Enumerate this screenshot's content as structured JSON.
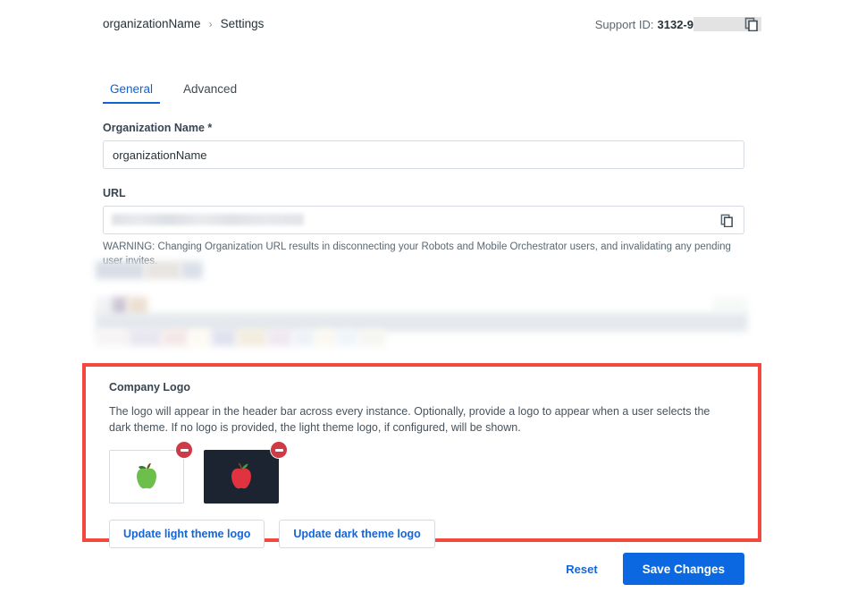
{
  "breadcrumb": {
    "organization": "organizationName",
    "separator": "›",
    "current": "Settings"
  },
  "support": {
    "label": "Support ID:",
    "value": "3132-9",
    "copy_icon": "copy-icon"
  },
  "tabs": [
    {
      "label": "General",
      "active": true
    },
    {
      "label": "Advanced",
      "active": false
    }
  ],
  "form": {
    "org_name": {
      "label": "Organization Name *",
      "value": "organizationName"
    },
    "url": {
      "label": "URL",
      "value": "",
      "copy_icon": "copy-icon",
      "warning": "WARNING: Changing Organization URL results in disconnecting your Robots and Mobile Orchestrator users, and invalidating any pending user invites."
    }
  },
  "logo_panel": {
    "title": "Company Logo",
    "description": "The logo will appear in the header bar across every instance. Optionally, provide a logo to appear when a user selects the dark theme. If no logo is provided, the light theme logo, if configured, will be shown.",
    "highlight_color": "#f4483f",
    "thumbnails": [
      {
        "name": "light-theme-logo",
        "theme": "light",
        "background": "#ffffff",
        "glyph": "🍏",
        "remove_label": "remove"
      },
      {
        "name": "dark-theme-logo",
        "theme": "dark",
        "background": "#1b2430",
        "glyph": "🍎",
        "remove_label": "remove"
      }
    ],
    "buttons": [
      {
        "label": "Update light theme logo"
      },
      {
        "label": "Update dark theme logo"
      }
    ]
  },
  "footer": {
    "reset_label": "Reset",
    "save_label": "Save Changes",
    "primary_color": "#0b68e0"
  }
}
